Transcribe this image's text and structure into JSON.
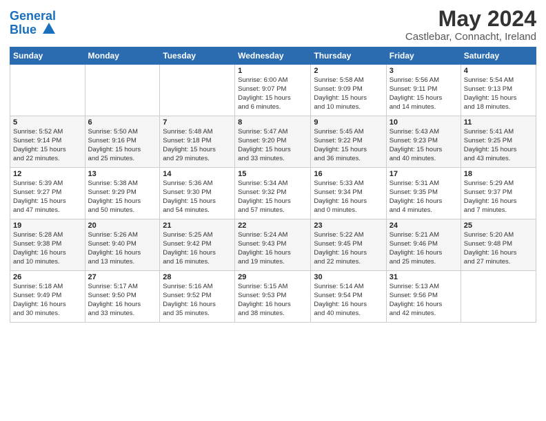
{
  "logo": {
    "line1": "General",
    "line2": "Blue"
  },
  "title": "May 2024",
  "subtitle": "Castlebar, Connacht, Ireland",
  "headers": [
    "Sunday",
    "Monday",
    "Tuesday",
    "Wednesday",
    "Thursday",
    "Friday",
    "Saturday"
  ],
  "weeks": [
    [
      {
        "day": "",
        "info": ""
      },
      {
        "day": "",
        "info": ""
      },
      {
        "day": "",
        "info": ""
      },
      {
        "day": "1",
        "info": "Sunrise: 6:00 AM\nSunset: 9:07 PM\nDaylight: 15 hours\nand 6 minutes."
      },
      {
        "day": "2",
        "info": "Sunrise: 5:58 AM\nSunset: 9:09 PM\nDaylight: 15 hours\nand 10 minutes."
      },
      {
        "day": "3",
        "info": "Sunrise: 5:56 AM\nSunset: 9:11 PM\nDaylight: 15 hours\nand 14 minutes."
      },
      {
        "day": "4",
        "info": "Sunrise: 5:54 AM\nSunset: 9:13 PM\nDaylight: 15 hours\nand 18 minutes."
      }
    ],
    [
      {
        "day": "5",
        "info": "Sunrise: 5:52 AM\nSunset: 9:14 PM\nDaylight: 15 hours\nand 22 minutes."
      },
      {
        "day": "6",
        "info": "Sunrise: 5:50 AM\nSunset: 9:16 PM\nDaylight: 15 hours\nand 25 minutes."
      },
      {
        "day": "7",
        "info": "Sunrise: 5:48 AM\nSunset: 9:18 PM\nDaylight: 15 hours\nand 29 minutes."
      },
      {
        "day": "8",
        "info": "Sunrise: 5:47 AM\nSunset: 9:20 PM\nDaylight: 15 hours\nand 33 minutes."
      },
      {
        "day": "9",
        "info": "Sunrise: 5:45 AM\nSunset: 9:22 PM\nDaylight: 15 hours\nand 36 minutes."
      },
      {
        "day": "10",
        "info": "Sunrise: 5:43 AM\nSunset: 9:23 PM\nDaylight: 15 hours\nand 40 minutes."
      },
      {
        "day": "11",
        "info": "Sunrise: 5:41 AM\nSunset: 9:25 PM\nDaylight: 15 hours\nand 43 minutes."
      }
    ],
    [
      {
        "day": "12",
        "info": "Sunrise: 5:39 AM\nSunset: 9:27 PM\nDaylight: 15 hours\nand 47 minutes."
      },
      {
        "day": "13",
        "info": "Sunrise: 5:38 AM\nSunset: 9:29 PM\nDaylight: 15 hours\nand 50 minutes."
      },
      {
        "day": "14",
        "info": "Sunrise: 5:36 AM\nSunset: 9:30 PM\nDaylight: 15 hours\nand 54 minutes."
      },
      {
        "day": "15",
        "info": "Sunrise: 5:34 AM\nSunset: 9:32 PM\nDaylight: 15 hours\nand 57 minutes."
      },
      {
        "day": "16",
        "info": "Sunrise: 5:33 AM\nSunset: 9:34 PM\nDaylight: 16 hours\nand 0 minutes."
      },
      {
        "day": "17",
        "info": "Sunrise: 5:31 AM\nSunset: 9:35 PM\nDaylight: 16 hours\nand 4 minutes."
      },
      {
        "day": "18",
        "info": "Sunrise: 5:29 AM\nSunset: 9:37 PM\nDaylight: 16 hours\nand 7 minutes."
      }
    ],
    [
      {
        "day": "19",
        "info": "Sunrise: 5:28 AM\nSunset: 9:38 PM\nDaylight: 16 hours\nand 10 minutes."
      },
      {
        "day": "20",
        "info": "Sunrise: 5:26 AM\nSunset: 9:40 PM\nDaylight: 16 hours\nand 13 minutes."
      },
      {
        "day": "21",
        "info": "Sunrise: 5:25 AM\nSunset: 9:42 PM\nDaylight: 16 hours\nand 16 minutes."
      },
      {
        "day": "22",
        "info": "Sunrise: 5:24 AM\nSunset: 9:43 PM\nDaylight: 16 hours\nand 19 minutes."
      },
      {
        "day": "23",
        "info": "Sunrise: 5:22 AM\nSunset: 9:45 PM\nDaylight: 16 hours\nand 22 minutes."
      },
      {
        "day": "24",
        "info": "Sunrise: 5:21 AM\nSunset: 9:46 PM\nDaylight: 16 hours\nand 25 minutes."
      },
      {
        "day": "25",
        "info": "Sunrise: 5:20 AM\nSunset: 9:48 PM\nDaylight: 16 hours\nand 27 minutes."
      }
    ],
    [
      {
        "day": "26",
        "info": "Sunrise: 5:18 AM\nSunset: 9:49 PM\nDaylight: 16 hours\nand 30 minutes."
      },
      {
        "day": "27",
        "info": "Sunrise: 5:17 AM\nSunset: 9:50 PM\nDaylight: 16 hours\nand 33 minutes."
      },
      {
        "day": "28",
        "info": "Sunrise: 5:16 AM\nSunset: 9:52 PM\nDaylight: 16 hours\nand 35 minutes."
      },
      {
        "day": "29",
        "info": "Sunrise: 5:15 AM\nSunset: 9:53 PM\nDaylight: 16 hours\nand 38 minutes."
      },
      {
        "day": "30",
        "info": "Sunrise: 5:14 AM\nSunset: 9:54 PM\nDaylight: 16 hours\nand 40 minutes."
      },
      {
        "day": "31",
        "info": "Sunrise: 5:13 AM\nSunset: 9:56 PM\nDaylight: 16 hours\nand 42 minutes."
      },
      {
        "day": "",
        "info": ""
      }
    ]
  ]
}
